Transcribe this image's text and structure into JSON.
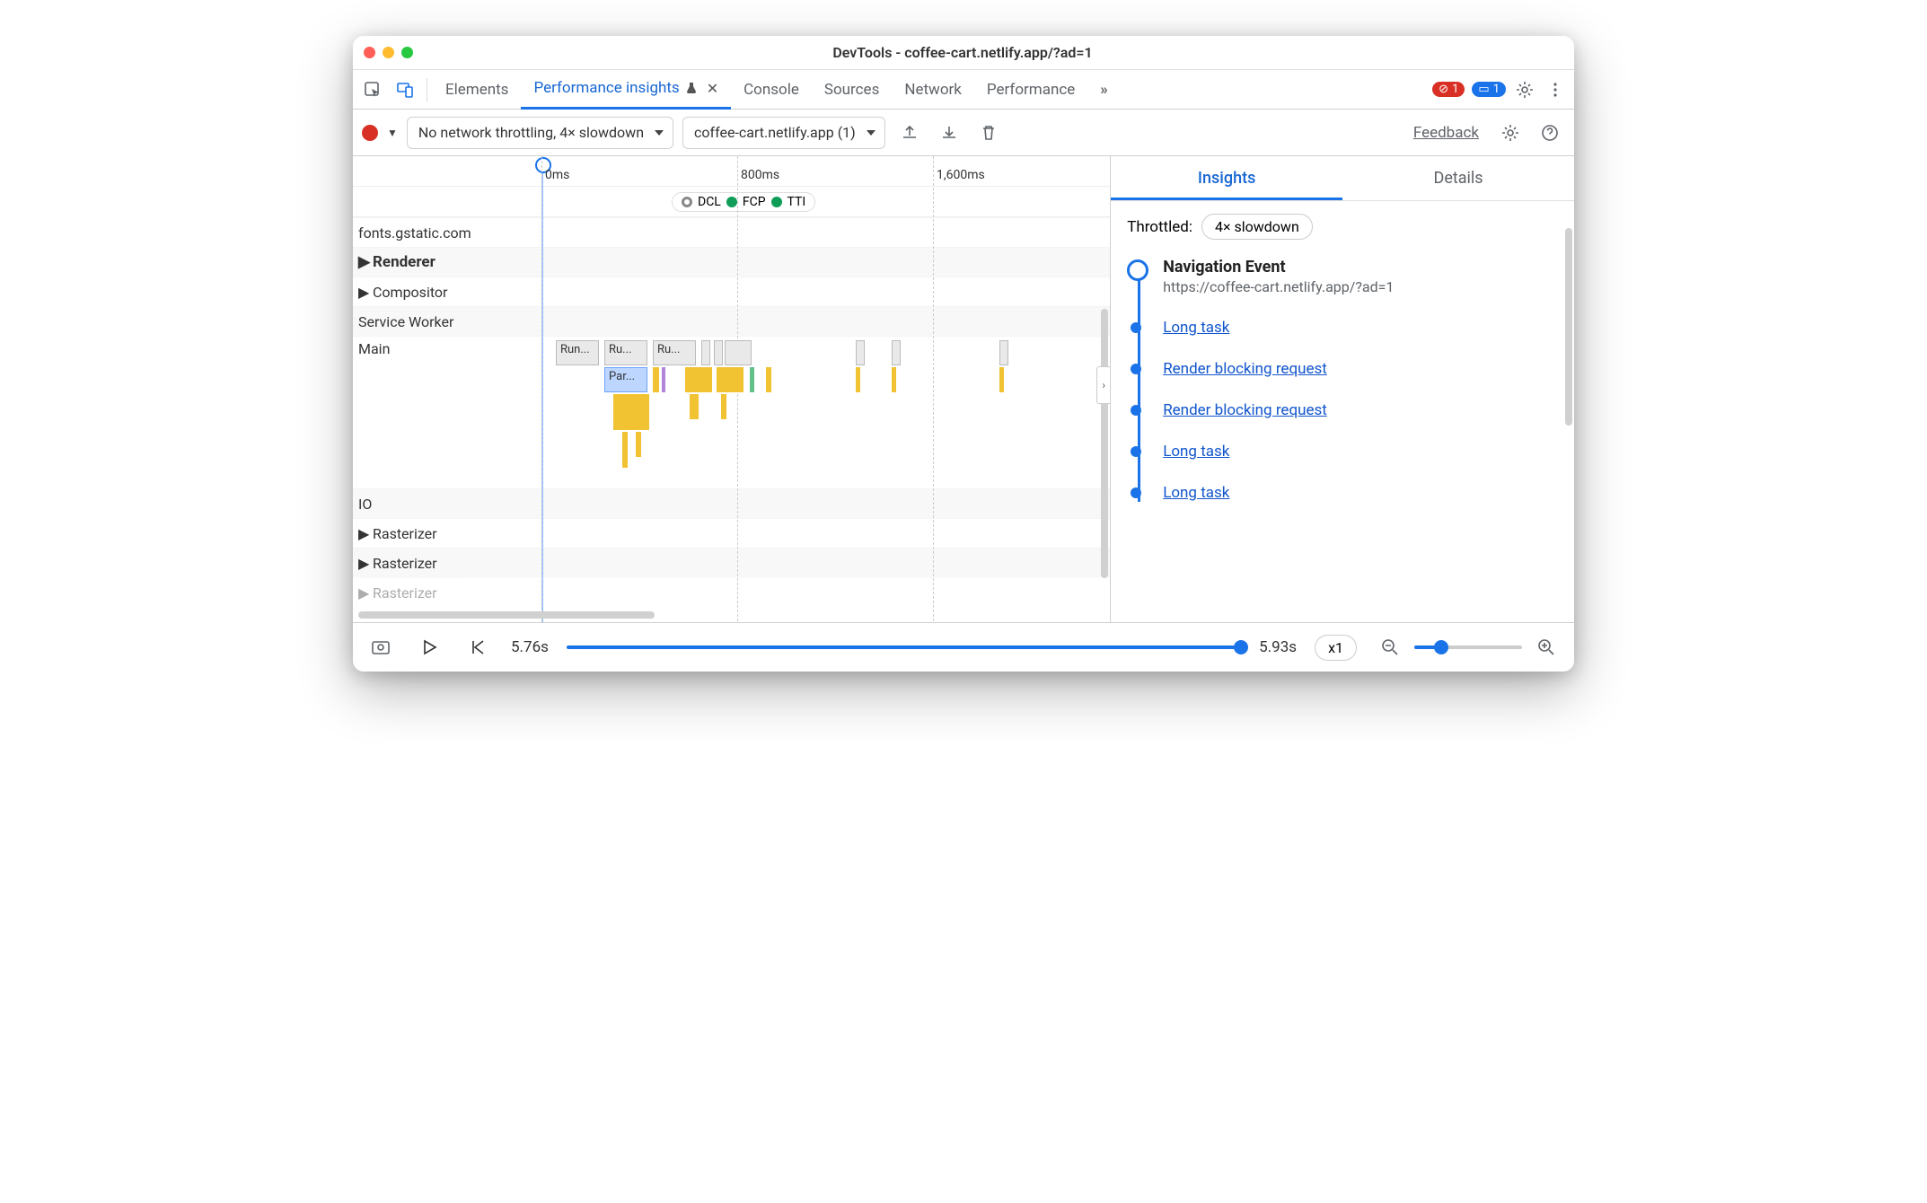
{
  "titlebar": {
    "title": "DevTools - coffee-cart.netlify.app/?ad=1"
  },
  "tabs": {
    "elements": "Elements",
    "perf_insights": "Performance insights",
    "console": "Console",
    "sources": "Sources",
    "network": "Network",
    "performance": "Performance",
    "more": "»",
    "close": "✕"
  },
  "badges": {
    "errors": "1",
    "info": "1"
  },
  "toolbar": {
    "throttling": "No network throttling, 4× slowdown",
    "target": "coffee-cart.netlify.app (1)",
    "feedback": "Feedback"
  },
  "timeline": {
    "ticks": [
      "0ms",
      "800ms",
      "1,600ms"
    ],
    "markers": {
      "dcl": "DCL",
      "fcp": "FCP",
      "tti": "TTI"
    }
  },
  "tracks": {
    "row0": "fonts.gstatic.com",
    "renderer": "Renderer",
    "compositor": "Compositor",
    "service_worker": "Service Worker",
    "main": "Main",
    "io": "IO",
    "rasterizer": "Rasterizer"
  },
  "flames": {
    "run": "Run...",
    "ru": "Ru...",
    "par": "Par..."
  },
  "right": {
    "tabs": {
      "insights": "Insights",
      "details": "Details"
    },
    "throttled_label": "Throttled:",
    "throttled_value": "4× slowdown",
    "nav_title": "Navigation Event",
    "nav_url": "https://coffee-cart.netlify.app/?ad=1",
    "items": [
      "Long task",
      "Render blocking request",
      "Render blocking request",
      "Long task",
      "Long task"
    ]
  },
  "bottom": {
    "ts_left": "5.76s",
    "ts_right": "5.93s",
    "zoom_label": "x1"
  },
  "colors": {
    "blue": "#1a73e8",
    "green": "#0f9d58",
    "red": "#d93025"
  }
}
